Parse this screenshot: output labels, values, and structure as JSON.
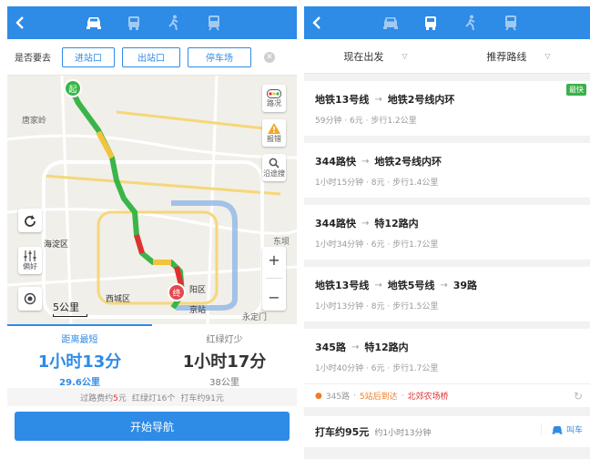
{
  "left": {
    "stop_question": "是否要去",
    "stop_buttons": [
      "进站口",
      "出站口",
      "停车场"
    ],
    "map": {
      "labels": [
        "唐家岭",
        "海淀区",
        "西城区",
        "阳区",
        "东坝",
        "永定门",
        "京站"
      ],
      "start_marker": "起",
      "end_marker": "终",
      "tool_traffic": "路况",
      "tool_report": "报错",
      "tool_search": "沿途搜",
      "tool_prefs": "偏好",
      "zoom_in": "+",
      "zoom_out": "−",
      "scale": "5公里"
    },
    "tabs": [
      {
        "name": "距离最短",
        "time": "1小时13分",
        "dist": "29.6公里"
      },
      {
        "name": "红绿灯少",
        "time": "1小时17分",
        "dist": "38公里"
      }
    ],
    "trip": {
      "toll_prefix": "过路费约",
      "toll_value": "5",
      "toll_suffix": "元",
      "lights": "红绿灯16个",
      "taxi": "打车约91元"
    },
    "nav_button": "开始导航"
  },
  "right": {
    "filters": [
      "现在出发",
      "推荐路线"
    ],
    "routes": [
      {
        "segments": [
          "地铁13号线",
          "地铁2号线内环"
        ],
        "meta": "59分钟 · 6元 · 步行1.2公里",
        "badge": "最快"
      },
      {
        "segments": [
          "344路快",
          "地铁2号线内环"
        ],
        "meta": "1小时15分钟 · 8元 · 步行1.4公里"
      },
      {
        "segments": [
          "344路快",
          "特12路内"
        ],
        "meta": "1小时34分钟 · 6元 · 步行1.7公里"
      },
      {
        "segments": [
          "地铁13号线",
          "地铁5号线",
          "39路"
        ],
        "meta": "1小时13分钟 · 8元 · 步行1.5公里"
      },
      {
        "segments": [
          "345路",
          "特12路内"
        ],
        "meta": "1小时40分钟 · 6元 · 步行1.7公里"
      }
    ],
    "tip": {
      "line": "345路",
      "stations": "5站后到达",
      "stop": "北郊农场桥"
    },
    "taxi": {
      "title": "打车约95元",
      "sub": "约1小时13分钟",
      "button": "叫车"
    }
  },
  "colors": {
    "accent": "#2e8be6",
    "fast_badge": "#3bb04a",
    "red": "#e03030",
    "orange": "#f07b24"
  }
}
